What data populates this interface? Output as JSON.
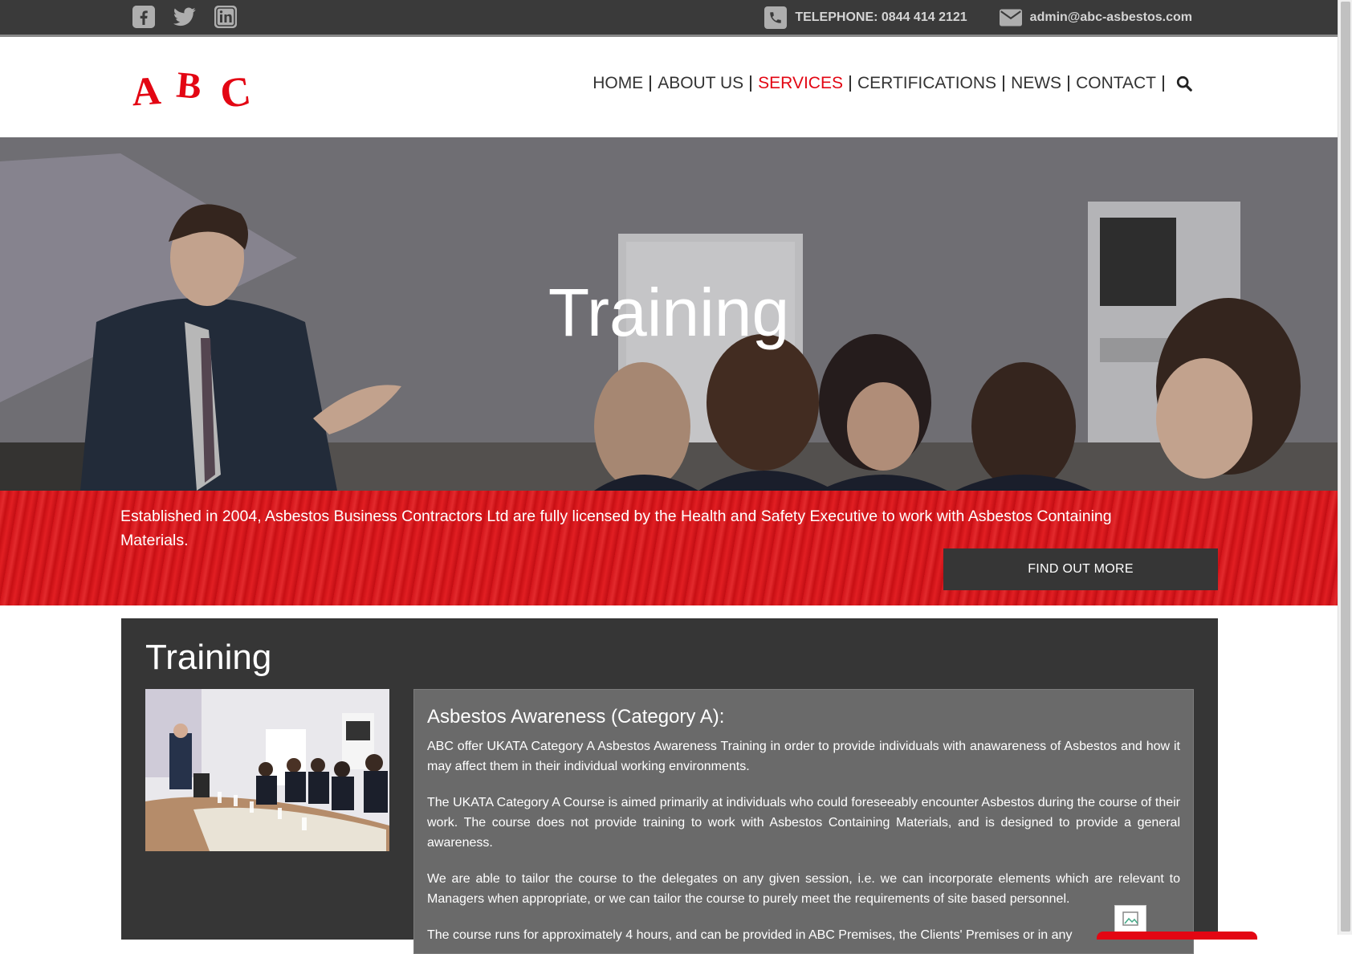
{
  "topbar": {
    "social": [
      "facebook-icon",
      "twitter-icon",
      "linkedin-icon"
    ],
    "telephone": "TELEPHONE: 0844 414 2121",
    "email": "admin@abc-asbestos.com"
  },
  "brand": {
    "logo_text": "ABC",
    "accent": "#e30613",
    "dark": "#363636"
  },
  "nav": {
    "items": [
      "HOME",
      "ABOUT US",
      "SERVICES",
      "CERTIFICATIONS",
      "NEWS",
      "CONTACT"
    ],
    "active": "SERVICES"
  },
  "hero": {
    "title": "Training"
  },
  "banner": {
    "tagline": "Established in 2004, Asbestos Business Contractors Ltd are fully licensed by the Health and Safety Executive to work with Asbestos Containing Materials.",
    "button": "FIND OUT MORE"
  },
  "main": {
    "title": "Training",
    "course_heading": "Asbestos Awareness (Category A):",
    "paragraphs": [
      "ABC offer UKATA Category A Asbestos Awareness Training in order to provide individuals with anawareness of Asbestos and how it may affect them in their individual working environments.",
      "The UKATA Category A Course is aimed primarily at individuals who could foreseeably encounter Asbestos during the course of their work. The course does not provide training to work with Asbestos Containing Materials, and is designed to provide a general awareness.",
      "We are able to tailor the course to the delegates on any given session, i.e. we can incorporate elements which are relevant to Managers when appropriate, or we can tailor the course to purely meet the requirements of site based personnel.",
      "The course runs for approximately 4 hours, and can be provided in ABC Premises, the Clients' Premises or in any"
    ]
  }
}
